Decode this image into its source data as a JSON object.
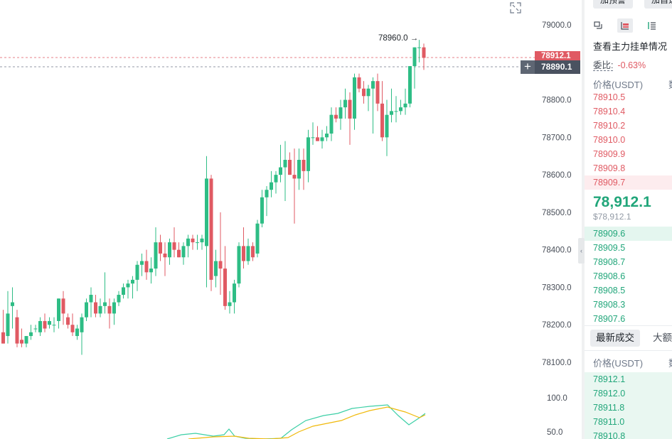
{
  "chart": {
    "axis_labels": [
      "79000.0",
      "78800.0",
      "78700.0",
      "78600.0",
      "78500.0",
      "78400.0",
      "78300.0",
      "78200.0",
      "78100.0"
    ],
    "indicator_axis_labels": [
      "100.0",
      "50.0"
    ],
    "max_annotation": "78960.0 →",
    "tag_top": "78912.1",
    "tag_bottom": "78890.1",
    "crosshair_symbol": "+",
    "colors": {
      "up": "#2ebd85",
      "down": "#e05a63",
      "ma_fast": "#3ccfa6",
      "ma_slow": "#f0b90b"
    },
    "candles": [
      [
        78180,
        78240,
        78150,
        78150
      ],
      [
        78170,
        78290,
        78150,
        78230
      ],
      [
        78250,
        78300,
        78190,
        78260
      ],
      [
        78220,
        78240,
        78140,
        78150
      ],
      [
        78160,
        78190,
        78140,
        78150
      ],
      [
        78150,
        78170,
        78140,
        78170
      ],
      [
        78170,
        78200,
        78160,
        78180
      ],
      [
        78190,
        78200,
        78180,
        78190
      ],
      [
        78180,
        78220,
        78170,
        78210
      ],
      [
        78210,
        78230,
        78180,
        78190
      ],
      [
        78200,
        78220,
        78190,
        78210
      ],
      [
        78200,
        78220,
        78180,
        78200
      ],
      [
        78210,
        78270,
        78190,
        78270
      ],
      [
        78270,
        78290,
        78200,
        78230
      ],
      [
        78220,
        78230,
        78190,
        78200
      ],
      [
        78200,
        78230,
        78170,
        78180
      ],
      [
        78170,
        78200,
        78160,
        78190
      ],
      [
        78180,
        78230,
        78120,
        78220
      ],
      [
        78220,
        78270,
        78210,
        78260
      ],
      [
        78260,
        78300,
        78220,
        78280
      ],
      [
        78260,
        78280,
        78220,
        78230
      ],
      [
        78230,
        78270,
        78220,
        78250
      ],
      [
        78250,
        78340,
        78230,
        78260
      ],
      [
        78250,
        78270,
        78190,
        78230
      ],
      [
        78230,
        78270,
        78200,
        78260
      ],
      [
        78260,
        78290,
        78250,
        78280
      ],
      [
        78280,
        78310,
        78270,
        78300
      ],
      [
        78300,
        78320,
        78270,
        78310
      ],
      [
        78310,
        78330,
        78270,
        78320
      ],
      [
        78320,
        78370,
        78290,
        78360
      ],
      [
        78360,
        78390,
        78330,
        78370
      ],
      [
        78370,
        78400,
        78320,
        78340
      ],
      [
        78340,
        78380,
        78310,
        78350
      ],
      [
        78350,
        78460,
        78330,
        78420
      ],
      [
        78420,
        78440,
        78370,
        78390
      ],
      [
        78390,
        78420,
        78330,
        78380
      ],
      [
        78380,
        78430,
        78360,
        78420
      ],
      [
        78420,
        78460,
        78380,
        78400
      ],
      [
        78400,
        78420,
        78380,
        78380
      ],
      [
        78380,
        78420,
        78360,
        78410
      ],
      [
        78410,
        78440,
        78380,
        78430
      ],
      [
        78430,
        78440,
        78400,
        78420
      ],
      [
        78420,
        78440,
        78400,
        78420
      ],
      [
        78420,
        78440,
        78400,
        78430
      ],
      [
        78410,
        78650,
        78300,
        78590
      ],
      [
        78590,
        78600,
        78290,
        78320
      ],
      [
        78330,
        78400,
        78300,
        78370
      ],
      [
        78370,
        78500,
        78280,
        78350
      ],
      [
        78350,
        78410,
        78240,
        78250
      ],
      [
        78250,
        78290,
        78230,
        78260
      ],
      [
        78260,
        78320,
        78230,
        78310
      ],
      [
        78310,
        78420,
        78300,
        78410
      ],
      [
        78410,
        78460,
        78350,
        78370
      ],
      [
        78370,
        78430,
        78360,
        78410
      ],
      [
        78410,
        78420,
        78370,
        78380
      ],
      [
        78390,
        78480,
        78380,
        78470
      ],
      [
        78470,
        78560,
        78460,
        78540
      ],
      [
        78540,
        78570,
        78490,
        78560
      ],
      [
        78560,
        78610,
        78540,
        78580
      ],
      [
        78580,
        78610,
        78550,
        78600
      ],
      [
        78600,
        78680,
        78580,
        78620
      ],
      [
        78620,
        78690,
        78530,
        78640
      ],
      [
        78640,
        78660,
        78600,
        78600
      ],
      [
        78600,
        78670,
        78470,
        78590
      ],
      [
        78590,
        78670,
        78560,
        78640
      ],
      [
        78640,
        78670,
        78560,
        78610
      ],
      [
        78610,
        78720,
        78580,
        78700
      ],
      [
        78700,
        78740,
        78680,
        78700
      ],
      [
        78700,
        78730,
        78690,
        78690
      ],
      [
        78690,
        78720,
        78670,
        78700
      ],
      [
        78700,
        78730,
        78690,
        78710
      ],
      [
        78710,
        78780,
        78690,
        78760
      ],
      [
        78760,
        78780,
        78740,
        78750
      ],
      [
        78750,
        78800,
        78720,
        78780
      ],
      [
        78780,
        78830,
        78750,
        78800
      ],
      [
        78800,
        78820,
        78680,
        78750
      ],
      [
        78750,
        78870,
        78720,
        78860
      ],
      [
        78860,
        78870,
        78820,
        78830
      ],
      [
        78830,
        78850,
        78790,
        78810
      ],
      [
        78810,
        78840,
        78770,
        78830
      ],
      [
        78830,
        78860,
        78710,
        78850
      ],
      [
        78850,
        78870,
        78770,
        78790
      ],
      [
        78790,
        78850,
        78690,
        78700
      ],
      [
        78700,
        78800,
        78650,
        78760
      ],
      [
        78760,
        78830,
        78740,
        78770
      ],
      [
        78770,
        78810,
        78740,
        78770
      ],
      [
        78770,
        78800,
        78760,
        78780
      ],
      [
        78780,
        78830,
        78760,
        78790
      ],
      [
        78790,
        78890,
        78780,
        78890
      ],
      [
        78890,
        78940,
        78830,
        78940
      ],
      [
        78940,
        78960,
        78900,
        78940
      ],
      [
        78940,
        78950,
        78880,
        78912
      ]
    ]
  },
  "orderbook": {
    "top_buttons": [
      "加预警",
      "加自选"
    ],
    "title": "查看主力挂单情况",
    "ratio_label": "委比:",
    "ratio_value": "-0.63%",
    "col_price": "价格(USDT)",
    "col_second": "数",
    "asks": [
      "78910.5",
      "78910.4",
      "78910.2",
      "78910.0",
      "78909.9",
      "78909.8",
      "78909.7"
    ],
    "last_price": "78,912.1",
    "last_price_usd": "$78,912.1",
    "bids": [
      "78909.6",
      "78909.5",
      "78908.7",
      "78908.6",
      "78908.5",
      "78908.3",
      "78907.6"
    ],
    "tabs": [
      "最新成交",
      "大额"
    ],
    "trades_col_price": "价格(USDT)",
    "trades_col_second": "数",
    "trades": [
      "78912.1",
      "78912.0",
      "78911.8",
      "78911.0",
      "78910.8"
    ]
  }
}
